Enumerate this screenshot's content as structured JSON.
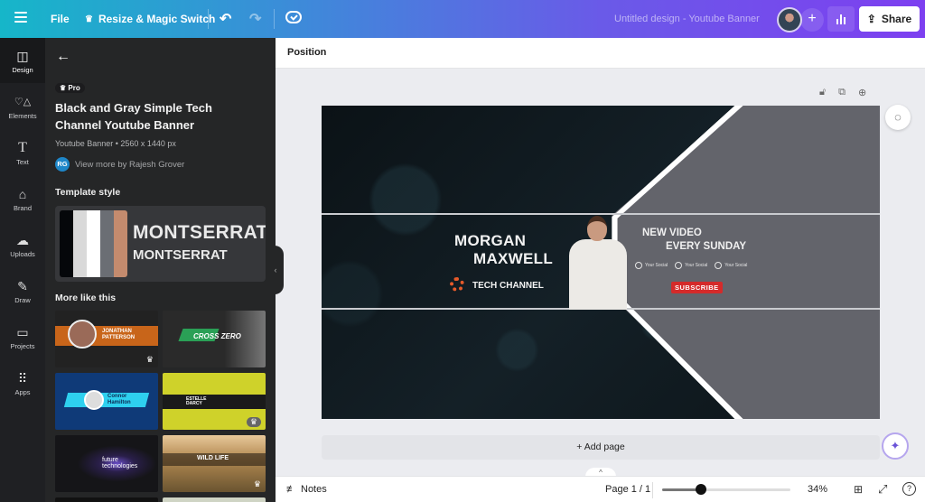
{
  "topbar": {
    "menu_icon": "hamburger-icon",
    "file_label": "File",
    "resize_label": "Resize & Magic Switch",
    "resize_icon": "crown-icon",
    "undo_icon": "undo-icon",
    "redo_icon": "redo-icon",
    "save_status_icon": "cloud-check-icon",
    "document_title": "Untitled design - Youtube Banner",
    "add_collaborator": "+",
    "share_label": "Share"
  },
  "rail": {
    "items": [
      {
        "label": "Design",
        "icon": "layout-icon",
        "glyph": "◫",
        "active": true
      },
      {
        "label": "Elements",
        "icon": "shapes-icon",
        "glyph": "♡△",
        "active": false
      },
      {
        "label": "Text",
        "icon": "text-icon",
        "glyph": "T",
        "active": false
      },
      {
        "label": "Brand",
        "icon": "brand-icon",
        "glyph": "⌂",
        "active": false
      },
      {
        "label": "Uploads",
        "icon": "cloud-upload-icon",
        "glyph": "☁",
        "active": false
      },
      {
        "label": "Draw",
        "icon": "pen-icon",
        "glyph": "✎",
        "active": false
      },
      {
        "label": "Projects",
        "icon": "folder-icon",
        "glyph": "▭",
        "active": false
      },
      {
        "label": "Apps",
        "icon": "apps-grid-icon",
        "glyph": "⠿",
        "active": false
      }
    ]
  },
  "panel": {
    "badge": "Pro",
    "template_title": "Black and Gray Simple Tech Channel Youtube Banner",
    "template_meta": "Youtube Banner • 2560 x 1440 px",
    "author_initials": "RG",
    "author_link": "View more by Rajesh Grover",
    "template_style_heading": "Template style",
    "palette": [
      "#05070a",
      "#d9d9d9",
      "#ffffff",
      "#6b6e74",
      "#c48b6e"
    ],
    "font_heading": "MONTSERRAT",
    "font_body": "MONTSERRAT",
    "more_heading": "More like this",
    "thumbnails": [
      {
        "text": "JONATHAN PATTERSON",
        "pro": true
      },
      {
        "text": "CROSS ZERO",
        "pro": false
      },
      {
        "text": "Connor Hamilton",
        "pro": false
      },
      {
        "text": "ESTELLE DARCY",
        "pro": true
      },
      {
        "text": "future technologies",
        "pro": false
      },
      {
        "text": "WILD LIFE",
        "pro": true
      }
    ]
  },
  "context_toolbar": {
    "position_label": "Position"
  },
  "banner": {
    "name_line1": "MORGAN",
    "name_line2": "MAXWELL",
    "channel": "TECH CHANNEL",
    "tagline1": "NEW VIDEO",
    "tagline2": "EVERY SUNDAY",
    "socials": [
      "Your Social",
      "Your Social",
      "Your Social"
    ],
    "subscribe": "SUBSCRIBE"
  },
  "canvas": {
    "add_page_label": "+ Add page"
  },
  "footer": {
    "notes_label": "Notes",
    "page_indicator": "Page 1 / 1",
    "zoom_value": "34%",
    "zoom_fraction": 0.3
  }
}
